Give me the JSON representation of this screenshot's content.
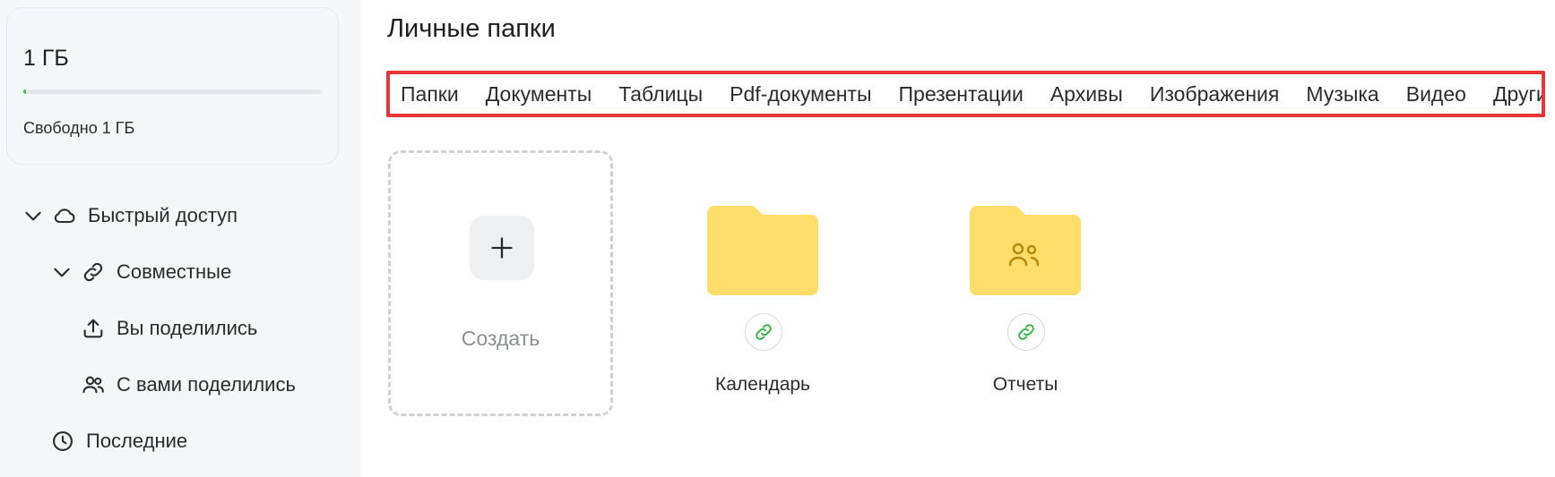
{
  "storage": {
    "total": "1 ГБ",
    "free_label": "Свободно 1 ГБ",
    "used_fraction": 0.01,
    "bar_color": "#3fbf3f"
  },
  "sidebar": {
    "items": [
      {
        "label": "Быстрый доступ",
        "icon": "cloud-icon",
        "expanded": true
      },
      {
        "label": "Совместные",
        "icon": "link-icon",
        "expanded": true
      },
      {
        "label": "Вы поделились",
        "icon": "upload-icon"
      },
      {
        "label": "С вами поделились",
        "icon": "users-icon"
      },
      {
        "label": "Последние",
        "icon": "clock-icon"
      }
    ]
  },
  "main": {
    "title": "Личные папки",
    "filter_tabs": [
      "Папки",
      "Документы",
      "Таблицы",
      "Pdf-документы",
      "Презентации",
      "Архивы",
      "Изображения",
      "Музыка",
      "Видео",
      "Другие"
    ],
    "highlight_color": "#e8353b",
    "create_label": "Создать",
    "folders": [
      {
        "name": "Календарь",
        "icon": "folder-icon",
        "shared_link": true
      },
      {
        "name": "Отчеты",
        "icon": "shared-folder-icon",
        "shared_link": true
      }
    ],
    "folder_color": "#ffdd6b",
    "link_icon_color": "#3cb54a"
  }
}
